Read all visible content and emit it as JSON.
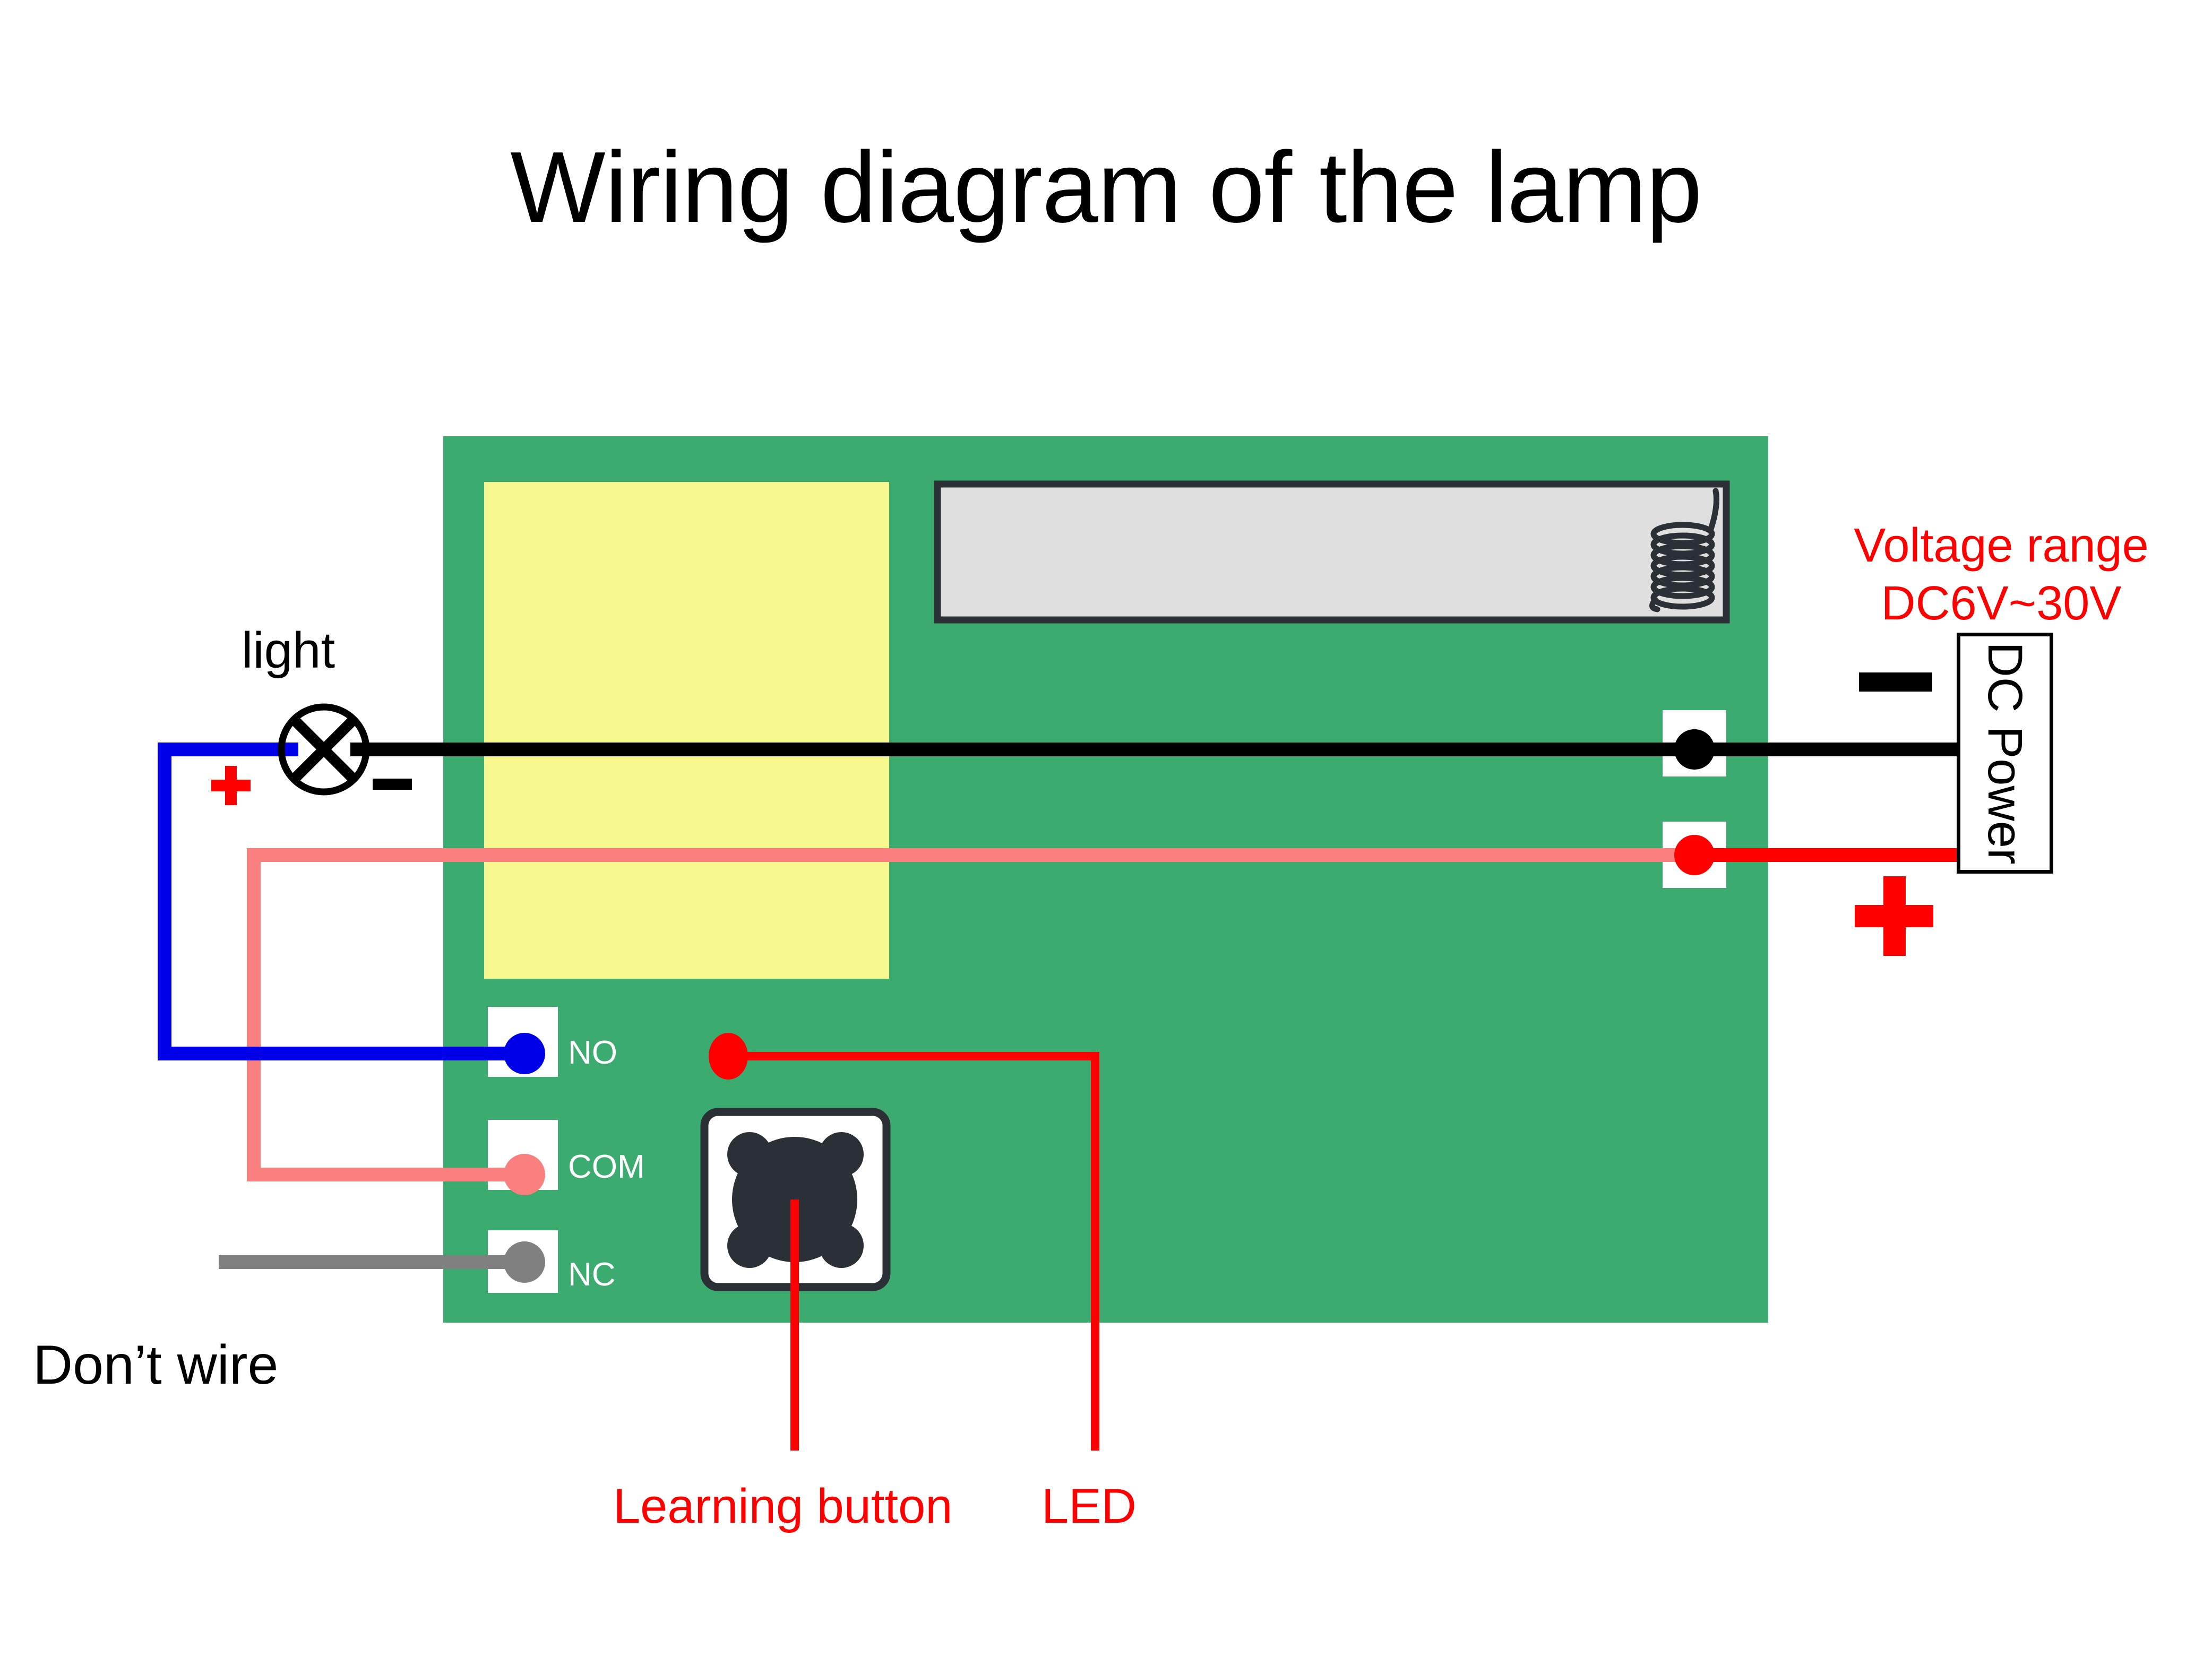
{
  "title": "Wiring diagram of the lamp",
  "colors": {
    "board_green": "#3CAB70",
    "relay_yellow": "#F7F88E",
    "module_gray": "#DFDFDF",
    "module_outline": "#2B2F36",
    "wire_black": "#000000",
    "wire_blue": "#0000E8",
    "wire_pink": "#FA8080",
    "wire_red": "#FF0000",
    "wire_gray": "#808080",
    "annotation_red": "#FF0000",
    "pad_white": "#FFFFFF",
    "button_body": "#FFFFFF",
    "button_dark": "#2B2F36"
  },
  "lamp": {
    "label": "light",
    "plus_sign": "+",
    "minus_sign": "–"
  },
  "board": {
    "relay_block_name": "relay",
    "rf_module_name": "rf-receiver-module",
    "antenna_name": "coil-antenna",
    "terminals": [
      {
        "id": "no",
        "label": "NO",
        "wire_color": "#0000E8"
      },
      {
        "id": "com",
        "label": "COM",
        "wire_color": "#FA8080"
      },
      {
        "id": "nc",
        "label": "NC",
        "wire_color": "#808080"
      }
    ],
    "power_pads": [
      {
        "id": "negative",
        "polarity": "–",
        "dot_color": "#000000"
      },
      {
        "id": "positive",
        "polarity": "+",
        "dot_color": "#FF0000"
      }
    ]
  },
  "power": {
    "box_label": "DC Power",
    "voltage_range_line1": "Voltage range",
    "voltage_range_line2": "DC6V~30V",
    "minus_sign": "–",
    "plus_sign": "+"
  },
  "callouts": {
    "dont_wire": "Don’t wire",
    "learning_button": "Learning button",
    "led": "LED"
  }
}
